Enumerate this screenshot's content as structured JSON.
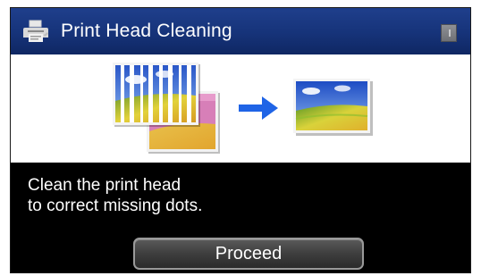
{
  "header": {
    "title": "Print Head Cleaning",
    "icon": "printer-icon",
    "status_icon": "battery-icon"
  },
  "illustration": {
    "before_image": "striped-landscape-print",
    "after_image": "clean-landscape-print",
    "arrow_color": "#1f64e6"
  },
  "message": {
    "line1": "Clean the print head",
    "line2": "to correct missing dots."
  },
  "footer": {
    "proceed_label": "Proceed"
  },
  "colors": {
    "title_bar": "#163379",
    "background": "#000000",
    "panel": "#ffffff"
  }
}
